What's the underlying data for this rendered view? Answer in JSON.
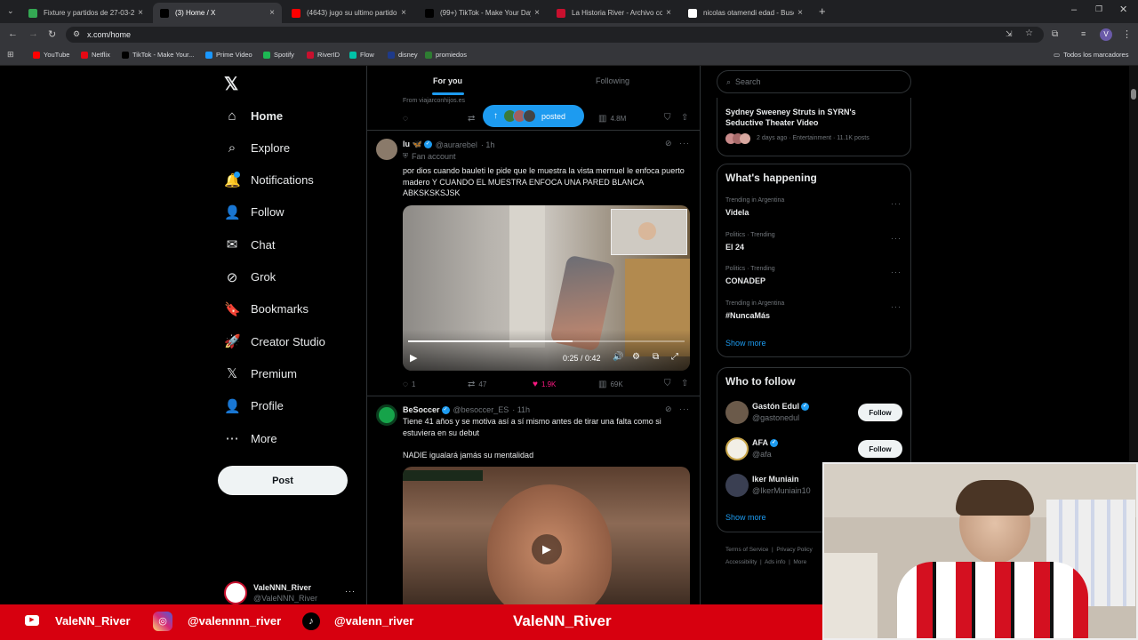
{
  "browser": {
    "tabs": [
      {
        "title": "Fixture y partidos de 27-03-2025",
        "color": "#34a853"
      },
      {
        "title": "(3) Home / X",
        "color": "#000000"
      },
      {
        "title": "(4643) jugo su ultimo partido en",
        "color": "#ff0000"
      },
      {
        "title": "(99+) TikTok - Make Your Day",
        "color": "#000000"
      },
      {
        "title": "La Historia River - Archivo com",
        "color": "#c8102e"
      },
      {
        "title": "nicolas otamendi edad - Buscar",
        "color": "#ffffff"
      }
    ],
    "url": "x.com/home",
    "bookmarks": [
      {
        "label": "YouTube",
        "color": "#ff0000"
      },
      {
        "label": "Netflix",
        "color": "#e50914"
      },
      {
        "label": "TikTok - Make Your...",
        "color": "#000000"
      },
      {
        "label": "Prime Video",
        "color": "#1a98ff"
      },
      {
        "label": "Spotify",
        "color": "#1db954"
      },
      {
        "label": "RiverID",
        "color": "#c8102e"
      },
      {
        "label": "Flow",
        "color": "#00c2a8"
      },
      {
        "label": "disney",
        "color": "#1e3a8a"
      },
      {
        "label": "promiedos",
        "color": "#2e7d32"
      }
    ],
    "all_bookmarks": "Todos los marcadores"
  },
  "sidebar": {
    "items": [
      {
        "label": "Home",
        "icon": "home-icon",
        "glyph": "⌂"
      },
      {
        "label": "Explore",
        "icon": "search-icon",
        "glyph": "⌕"
      },
      {
        "label": "Notifications",
        "icon": "bell-icon",
        "glyph": "🔔"
      },
      {
        "label": "Follow",
        "icon": "person-plus-icon",
        "glyph": "👤"
      },
      {
        "label": "Chat",
        "icon": "mail-icon",
        "glyph": "✉"
      },
      {
        "label": "Grok",
        "icon": "grok-icon",
        "glyph": "⊘"
      },
      {
        "label": "Bookmarks",
        "icon": "bookmark-icon",
        "glyph": "🔖"
      },
      {
        "label": "Creator Studio",
        "icon": "rocket-icon",
        "glyph": "🚀"
      },
      {
        "label": "Premium",
        "icon": "x-logo-icon",
        "glyph": "𝕏"
      },
      {
        "label": "Profile",
        "icon": "person-icon",
        "glyph": "👤"
      },
      {
        "label": "More",
        "icon": "more-circle-icon",
        "glyph": "⋯"
      }
    ],
    "post_label": "Post",
    "account": {
      "name": "ValeNNN_River",
      "handle": "@ValeNNN_River"
    }
  },
  "feed": {
    "tabs": [
      "For you",
      "Following"
    ],
    "prev_tweet": {
      "from": "From viajarconhijos.es",
      "views": "4.8M"
    },
    "posted_pill": "posted",
    "tweet1": {
      "name": "lu 🦋",
      "handle": "@aurarebel",
      "time": "· 1h",
      "badge": "Fan account",
      "text": "por dios cuando bauleti le pide que le muestra la vista mernuel le enfoca puerto madero Y CUANDO EL MUESTRA ENFOCA UNA PARED BLANCA ABKSKSKSJSK",
      "video_time": "0:25 / 0:42",
      "video_progress": 0.595,
      "replies": "1",
      "reposts": "47",
      "likes": "1.9K",
      "views": "69K"
    },
    "tweet2": {
      "name": "BeSoccer",
      "handle": "@besoccer_ES",
      "time": "· 11h",
      "text": "Tiene 41 años y se motiva así a sí mismo antes de tirar una falta como si estuviera en su debut\n\nNADIE igualará jamás su mentalidad"
    }
  },
  "right": {
    "search_placeholder": "Search",
    "top_story": {
      "title": "Sydney Sweeney Struts in SYRN's Seductive Theater Video",
      "meta": "2 days ago · Entertainment · 11.1K posts"
    },
    "whats_happening": "What's happening",
    "trends": [
      {
        "category": "Trending in Argentina",
        "name": "Videla"
      },
      {
        "category": "Politics · Trending",
        "name": "El 24"
      },
      {
        "category": "Politics · Trending",
        "name": "CONADEP"
      },
      {
        "category": "Trending in Argentina",
        "name": "#NuncaMás"
      }
    ],
    "show_more": "Show more",
    "who_to_follow": "Who to follow",
    "suggestions": [
      {
        "name": "Gastón Edul",
        "handle": "@gastonedul",
        "button": "Follow"
      },
      {
        "name": "AFA",
        "handle": "@afa",
        "button": "Follow"
      },
      {
        "name": "Iker Muniain",
        "handle": "@IkerMuniain10"
      }
    ],
    "show_more_2": "Show more",
    "footer": [
      "Terms of Service",
      "Privacy Policy",
      "Accessibility",
      "Ads info",
      "More"
    ]
  },
  "stream_banner": {
    "youtube": "ValeNN_River",
    "instagram": "@valennnn_river",
    "tiktok": "@valenn_river",
    "center": "ValeNN_River"
  }
}
